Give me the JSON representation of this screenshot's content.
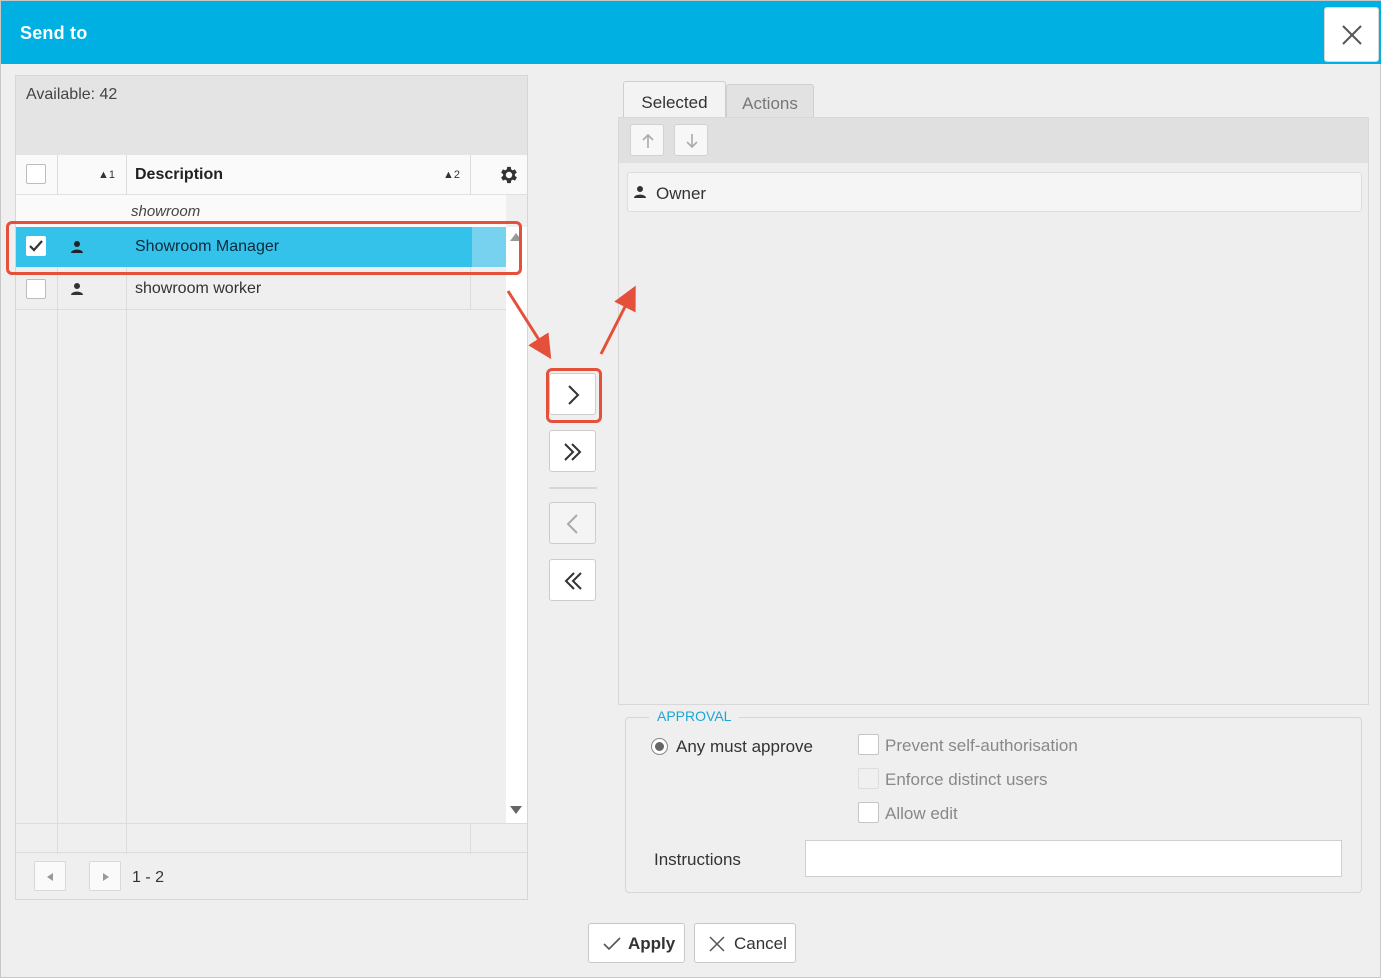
{
  "window": {
    "title": "Send to",
    "close_icon": "close-icon"
  },
  "available": {
    "label": "Available: 42"
  },
  "grid": {
    "headers": {
      "sort1": "▲1",
      "description": "Description",
      "sort2": "▲2"
    },
    "filter_value": "showroom",
    "rows": [
      {
        "label": "Showroom Manager",
        "checked": true,
        "icon": "person-icon"
      },
      {
        "label": "showroom worker",
        "checked": false,
        "icon": "person-icon"
      }
    ],
    "pager_text": "1 - 2"
  },
  "transfer_buttons": [
    {
      "name": "move-selected-right-button",
      "icon": "chevron-right-icon"
    },
    {
      "name": "move-all-right-button",
      "icon": "double-chevron-right-icon"
    },
    {
      "name": "move-selected-left-button",
      "icon": "chevron-left-icon"
    },
    {
      "name": "move-all-left-button",
      "icon": "double-chevron-left-icon"
    }
  ],
  "tabs": {
    "selected": "Selected",
    "actions": "Actions"
  },
  "selected_list": {
    "items": [
      "Owner"
    ]
  },
  "approval": {
    "legend": "APPROVAL",
    "radio_label": "Any must approve",
    "checkboxes": [
      "Prevent self-authorisation",
      "Enforce distinct users",
      "Allow edit"
    ],
    "instructions_label": "Instructions",
    "instructions_value": ""
  },
  "buttons": {
    "apply": "Apply",
    "cancel": "Cancel"
  },
  "colors": {
    "titlebar": "#00b0e2",
    "selected_row": "#35c2ea",
    "annotation": "#e4503a",
    "legend": "#1aa6d6"
  }
}
